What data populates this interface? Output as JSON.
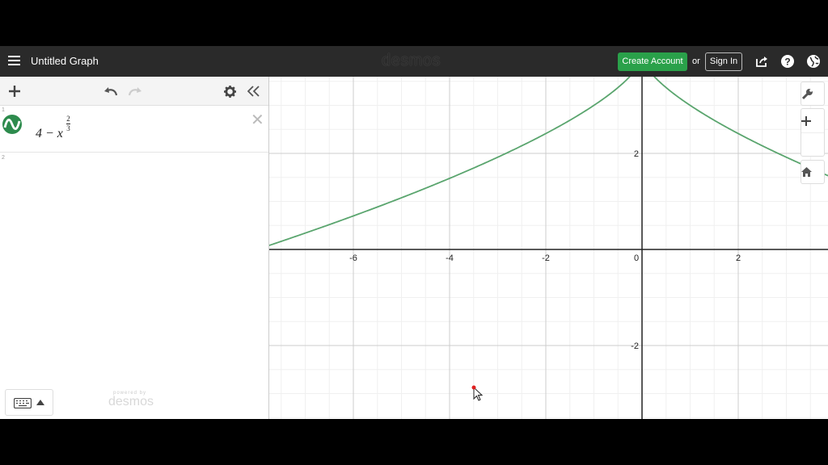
{
  "header": {
    "title": "Untitled Graph",
    "brand": "desmos",
    "create_account": "Create Account",
    "or": "or",
    "sign_in": "Sign In",
    "icons": [
      "share-icon",
      "help-icon",
      "globe-icon"
    ]
  },
  "expressions": [
    {
      "index": "1",
      "latex": "4 - x^(2/3)",
      "base": "4 − x",
      "exp_num": "2",
      "exp_den": "3",
      "color": "#2d8b4d"
    },
    {
      "index": "2"
    }
  ],
  "footer": {
    "powered_by": "powered by",
    "brand": "desmos"
  },
  "graph": {
    "x_ticks": [
      "-6",
      "-4",
      "-2",
      "0",
      "2"
    ],
    "y_ticks": [
      "2",
      "-2"
    ],
    "curve_color": "#5aa56e",
    "axis_color": "#222222",
    "grid_color": "#cccccc"
  },
  "colors": {
    "accent": "#2aa14a",
    "header_bg": "#2a2a2a"
  }
}
